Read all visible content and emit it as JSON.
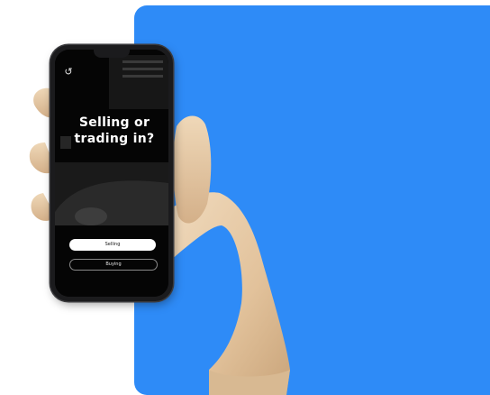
{
  "phone": {
    "title_line1": "Selling or",
    "title_line2": "trading in?",
    "buttons": {
      "selling_label": "Selling",
      "buying_label": "Buying"
    },
    "icons": {
      "back": "back-arrow-icon"
    }
  },
  "colors": {
    "panel_blue": "#2e8bf7",
    "screen_bg": "#050505",
    "button_white": "#ffffff"
  }
}
